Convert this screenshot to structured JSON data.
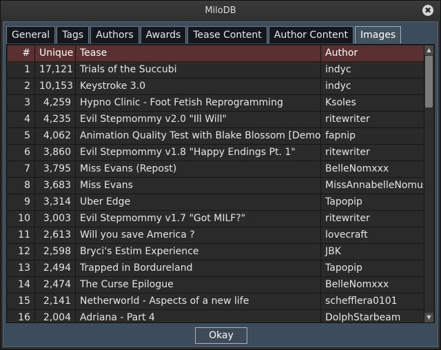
{
  "window": {
    "title": "MiloDB",
    "close_glyph": "✖"
  },
  "tabs": [
    {
      "label": "General",
      "active": false
    },
    {
      "label": "Tags",
      "active": false
    },
    {
      "label": "Authors",
      "active": false
    },
    {
      "label": "Awards",
      "active": false
    },
    {
      "label": "Tease Content",
      "active": false
    },
    {
      "label": "Author Content",
      "active": false
    },
    {
      "label": "Images",
      "active": true
    }
  ],
  "table": {
    "headers": {
      "num": "#",
      "unique": "Unique",
      "tease": "Tease",
      "author": "Author"
    },
    "rows": [
      {
        "num": "1",
        "unique": "17,121",
        "tease": "Trials of the Succubi",
        "author": "indyc"
      },
      {
        "num": "2",
        "unique": "10,153",
        "tease": "Keystroke 3.0",
        "author": "indyc"
      },
      {
        "num": "3",
        "unique": "4,259",
        "tease": "Hypno Clinic - Foot Fetish Reprogramming",
        "author": "Ksoles"
      },
      {
        "num": "4",
        "unique": "4,235",
        "tease": "Evil Stepmommy v2.0 \"Ill Will\"",
        "author": "ritewriter"
      },
      {
        "num": "5",
        "unique": "4,062",
        "tease": "Animation Quality Test with Blake Blossom [Demo]",
        "author": "fapnip"
      },
      {
        "num": "6",
        "unique": "3,860",
        "tease": "Evil Stepmommy v1.8 \"Happy Endings Pt. 1\"",
        "author": "ritewriter"
      },
      {
        "num": "7",
        "unique": "3,795",
        "tease": "Miss Evans (Repost)",
        "author": "BelleNomxxx"
      },
      {
        "num": "8",
        "unique": "3,683",
        "tease": "Miss Evans",
        "author": "MissAnnabelleNomus"
      },
      {
        "num": "9",
        "unique": "3,314",
        "tease": "Uber Edge",
        "author": "Tapopip"
      },
      {
        "num": "10",
        "unique": "3,003",
        "tease": "Evil Stepmommy v1.7 \"Got MILF?\"",
        "author": "ritewriter"
      },
      {
        "num": "11",
        "unique": "2,613",
        "tease": "Will you save America ?",
        "author": "lovecraft"
      },
      {
        "num": "12",
        "unique": "2,598",
        "tease": "Bryci's Estim Experience",
        "author": "JBK"
      },
      {
        "num": "13",
        "unique": "2,494",
        "tease": "Trapped in Bordureland",
        "author": "Tapopip"
      },
      {
        "num": "14",
        "unique": "2,474",
        "tease": "The Curse Epilogue",
        "author": "BelleNomxxx"
      },
      {
        "num": "15",
        "unique": "2,141",
        "tease": "Netherworld - Aspects of a new life",
        "author": "schefflera0101"
      },
      {
        "num": "16",
        "unique": "2,004",
        "tease": "Adriana - Part 4",
        "author": "DolphStarbeam"
      }
    ]
  },
  "scrollbar": {
    "up_glyph": "▲",
    "down_glyph": "▼"
  },
  "footer": {
    "okay_label": "Okay"
  },
  "colors": {
    "header_bg": "#5a3030",
    "row_bg": "#2a2a2a",
    "frame_bg": "#3d4c5a"
  }
}
